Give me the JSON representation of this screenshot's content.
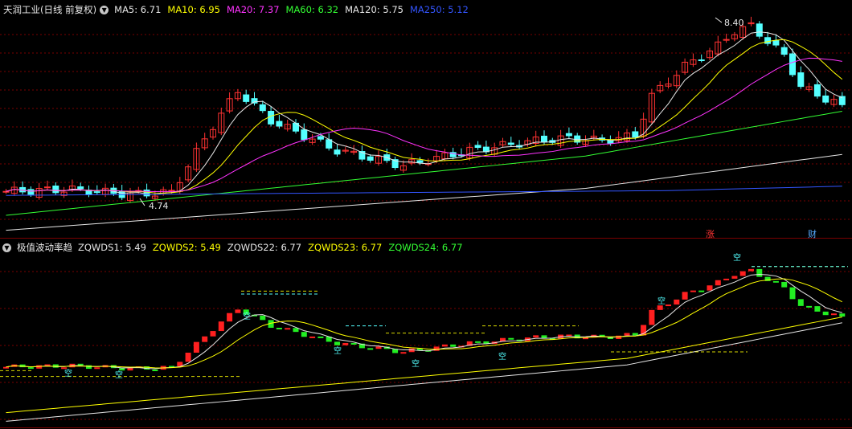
{
  "main_panel": {
    "title": "天润工业(日线 前复权)",
    "settings_icon": "chevron-down-icon",
    "indicators": [
      {
        "label": "MA5: 6.71",
        "color": "#e6e6e6"
      },
      {
        "label": "MA10: 6.95",
        "color": "#ffff00"
      },
      {
        "label": "MA20: 7.37",
        "color": "#ff33ff"
      },
      {
        "label": "MA60: 6.32",
        "color": "#33ff33"
      },
      {
        "label": "MA120: 5.75",
        "color": "#e6e6e6"
      },
      {
        "label": "MA250: 5.12",
        "color": "#3355ff"
      }
    ],
    "high_label": "8.40",
    "low_label": "4.74",
    "markers": [
      {
        "text": "涨",
        "color": "#ff3333"
      },
      {
        "text": "财",
        "color": "#55aaff"
      }
    ]
  },
  "sub_panel": {
    "title": "极值波动率趋",
    "settings_icon": "chevron-down-icon",
    "indicators": [
      {
        "label": "ZQWDS1: 5.49",
        "color": "#e6e6e6"
      },
      {
        "label": "ZQWDS2: 5.49",
        "color": "#ffff00"
      },
      {
        "label": "ZQWDS22: 6.77",
        "color": "#e6e6e6"
      },
      {
        "label": "ZQWDS23: 6.77",
        "color": "#ffff00"
      },
      {
        "label": "ZQWDS24: 6.77",
        "color": "#33ff33"
      }
    ],
    "marker_text": "空"
  },
  "colors": {
    "up": "#ff3232",
    "down": "#54ffff",
    "grid": "#7a0000",
    "sub_up": "#ff2020",
    "sub_down": "#22ee22"
  }
}
